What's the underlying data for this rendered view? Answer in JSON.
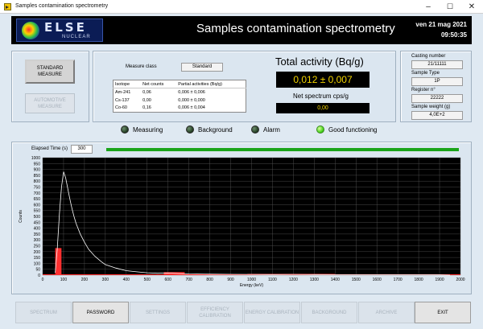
{
  "window": {
    "title": "Samples contamination spectrometry",
    "minimize": "–",
    "maximize": "☐",
    "close": "✕"
  },
  "header": {
    "logo_name": "ELSE",
    "logo_sub": "NUCLEAR",
    "title": "Samples contamination spectrometry",
    "date": "ven 21 mag 2021",
    "time": "09:50:35"
  },
  "measure_buttons": {
    "standard": "STANDARD MEASURE",
    "automotive": "AUTOMOTIVE MEASURE"
  },
  "measure": {
    "class_label": "Measure class",
    "class_value": "Standard",
    "columns": [
      "Isotope",
      "Net counts",
      "Partial activities (Bq/g)"
    ],
    "rows": [
      {
        "isotope": "Am-241",
        "counts": "0,06",
        "activity": "0,006  ±  0,006"
      },
      {
        "isotope": "Cs-137",
        "counts": "0,00",
        "activity": "0,000  ±  0,000"
      },
      {
        "isotope": "Co-60",
        "counts": "0,16",
        "activity": "0,006  ±  0,004"
      }
    ],
    "total_title": "Total activity (Bq/g)",
    "total_value": "0,012  ±  0,007",
    "net_title": "Net spectrum cps/g",
    "net_value": "0,00"
  },
  "sample": {
    "casting_label": "Casting number",
    "casting_value": "21/11111",
    "type_label": "Sample Type",
    "type_value": "1P",
    "register_label": "Register n°",
    "register_value": "22222",
    "weight_label": "Sample weight (g)",
    "weight_value": "4,0E+2"
  },
  "status": {
    "measuring": "Measuring",
    "background": "Background",
    "alarm": "Alarm",
    "good": "Good functioning",
    "good_on": true
  },
  "spectrum": {
    "elapsed_label": "Elapsed Time (s)",
    "elapsed_value": "300",
    "progress": 1.0
  },
  "chart_data": {
    "type": "line",
    "xlabel": "Energy (keV)",
    "ylabel": "Counts",
    "xlim": [
      0,
      2000
    ],
    "ylim": [
      0,
      1000
    ],
    "xticks": [
      0,
      100,
      200,
      300,
      400,
      500,
      600,
      700,
      800,
      900,
      1000,
      1100,
      1200,
      1300,
      1400,
      1500,
      1600,
      1700,
      1800,
      1900,
      2000
    ],
    "yticks": [
      0,
      50,
      100,
      150,
      200,
      250,
      300,
      350,
      400,
      450,
      500,
      550,
      600,
      650,
      700,
      750,
      800,
      850,
      900,
      950,
      1000
    ],
    "background": "#000000",
    "grid": true,
    "grid_color": "#5a5a5a",
    "line_color": "#ffffff",
    "roi_color": "#ff3030",
    "series": [
      {
        "x": [
          60,
          70,
          80,
          90,
          100,
          110,
          120,
          130,
          140,
          150,
          160,
          180,
          200,
          220,
          250,
          280,
          300,
          350,
          400,
          450,
          500,
          550,
          600,
          650,
          700,
          800,
          900,
          1000,
          1100,
          1200,
          1300,
          1400,
          1500,
          1600,
          1700,
          1800,
          1900,
          1950
        ],
        "y": [
          20,
          230,
          520,
          750,
          880,
          830,
          740,
          650,
          570,
          500,
          440,
          350,
          280,
          220,
          160,
          115,
          90,
          60,
          38,
          28,
          20,
          16,
          18,
          14,
          10,
          8,
          7,
          6,
          5,
          6,
          5,
          4,
          4,
          3,
          3,
          3,
          2,
          0
        ]
      }
    ],
    "regions": [
      {
        "name": "Am-241",
        "x": [
          60,
          90
        ],
        "peak": 230
      },
      {
        "name": "Cs-137",
        "x": [
          580,
          680
        ],
        "peak": 25
      },
      {
        "name": "Co-60",
        "x": [
          980,
          1400
        ],
        "peak": 10
      }
    ]
  },
  "bottom_buttons": [
    {
      "label": "SPECTRUM",
      "state": "disabled"
    },
    {
      "label": "PASSWORD",
      "state": "active"
    },
    {
      "label": "SETTINGS",
      "state": "disabled"
    },
    {
      "label": "EFFICIENCY CALIBRATION",
      "state": "disabled"
    },
    {
      "label": "ENERGY CALIBRATION",
      "state": "disabled"
    },
    {
      "label": "BACKGROUND",
      "state": "disabled"
    },
    {
      "label": "ARCHIVE",
      "state": "disabled"
    },
    {
      "label": "EXIT",
      "state": "active"
    }
  ]
}
